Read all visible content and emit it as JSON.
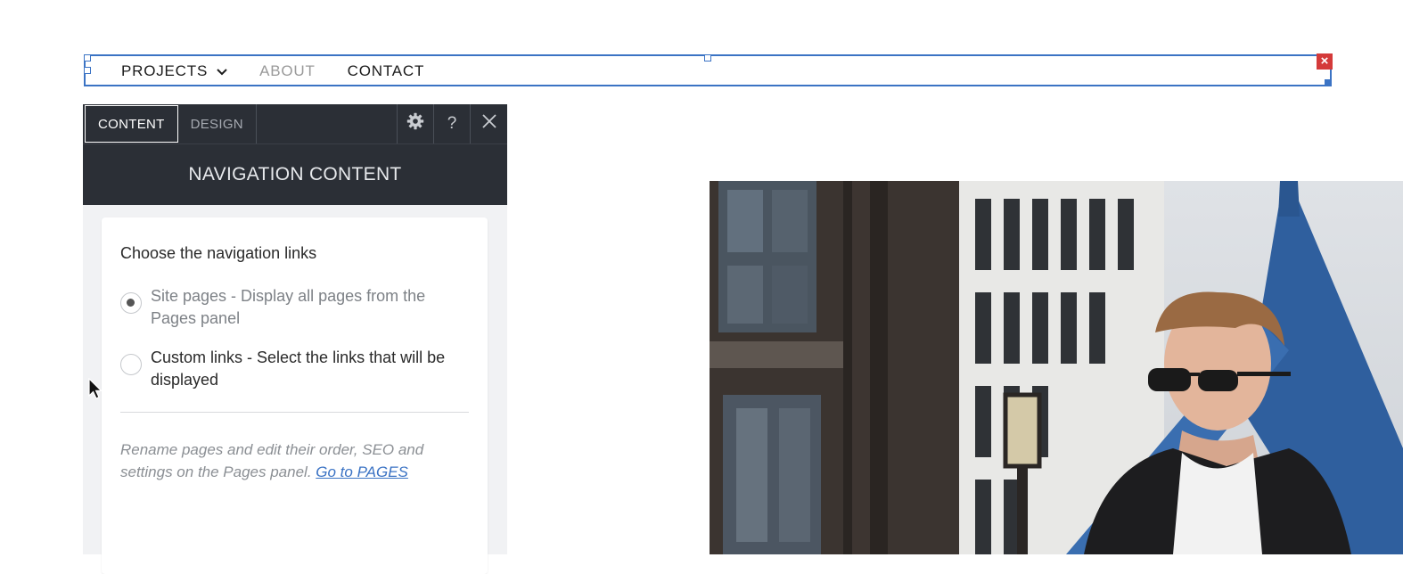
{
  "nav": {
    "items": [
      {
        "label": "PROJECTS",
        "has_dropdown": true
      },
      {
        "label": "ABOUT"
      },
      {
        "label": "CONTACT"
      }
    ],
    "close_label": "×"
  },
  "panel": {
    "tabs": [
      {
        "label": "CONTENT",
        "active": true
      },
      {
        "label": "DESIGN",
        "active": false
      }
    ],
    "tools": {
      "settings_icon": "gear-icon",
      "help_label": "?",
      "close_label": "✕"
    },
    "title": "NAVIGATION CONTENT",
    "card": {
      "heading": "Choose the navigation links",
      "options": [
        {
          "label": "Site pages - Display all pages from the Pages panel",
          "checked": true
        },
        {
          "label": "Custom links - Select the links that will be displayed",
          "checked": false
        }
      ],
      "note_text": "Rename pages and edit their order, SEO and settings on the Pages panel. ",
      "note_link": "Go to PAGES"
    }
  },
  "colors": {
    "accent": "#3b73c4",
    "panel_dark": "#2b2f36",
    "close_red": "#d43a3a"
  }
}
